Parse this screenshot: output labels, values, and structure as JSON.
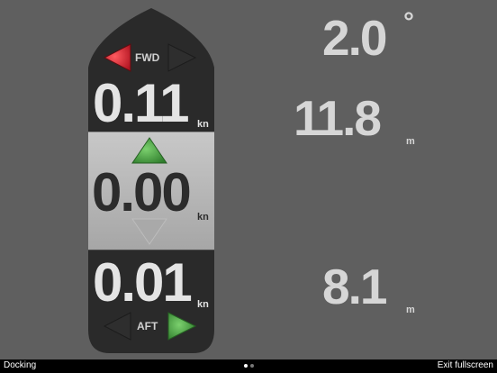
{
  "boat": {
    "fwd_label": "FWD",
    "aft_label": "AFT",
    "fwd_speed": "0.11",
    "fwd_unit": "kn",
    "center_speed": "0.00",
    "center_unit": "kn",
    "aft_speed": "0.01",
    "aft_unit": "kn"
  },
  "readouts": {
    "heading": "2.0",
    "heading_unit": "°",
    "depth_fwd": "11.8",
    "depth_fwd_unit": "m",
    "depth_aft": "8.1",
    "depth_aft_unit": "m"
  },
  "footer": {
    "title": "Docking",
    "exit_label": "Exit fullscreen"
  },
  "colors": {
    "background": "#5f5f5f",
    "hull": "#2a2a2a",
    "center_panel": "#b9b9b9",
    "red_arrow": "#d11f2a",
    "green_arrow": "#3f9a3a"
  }
}
